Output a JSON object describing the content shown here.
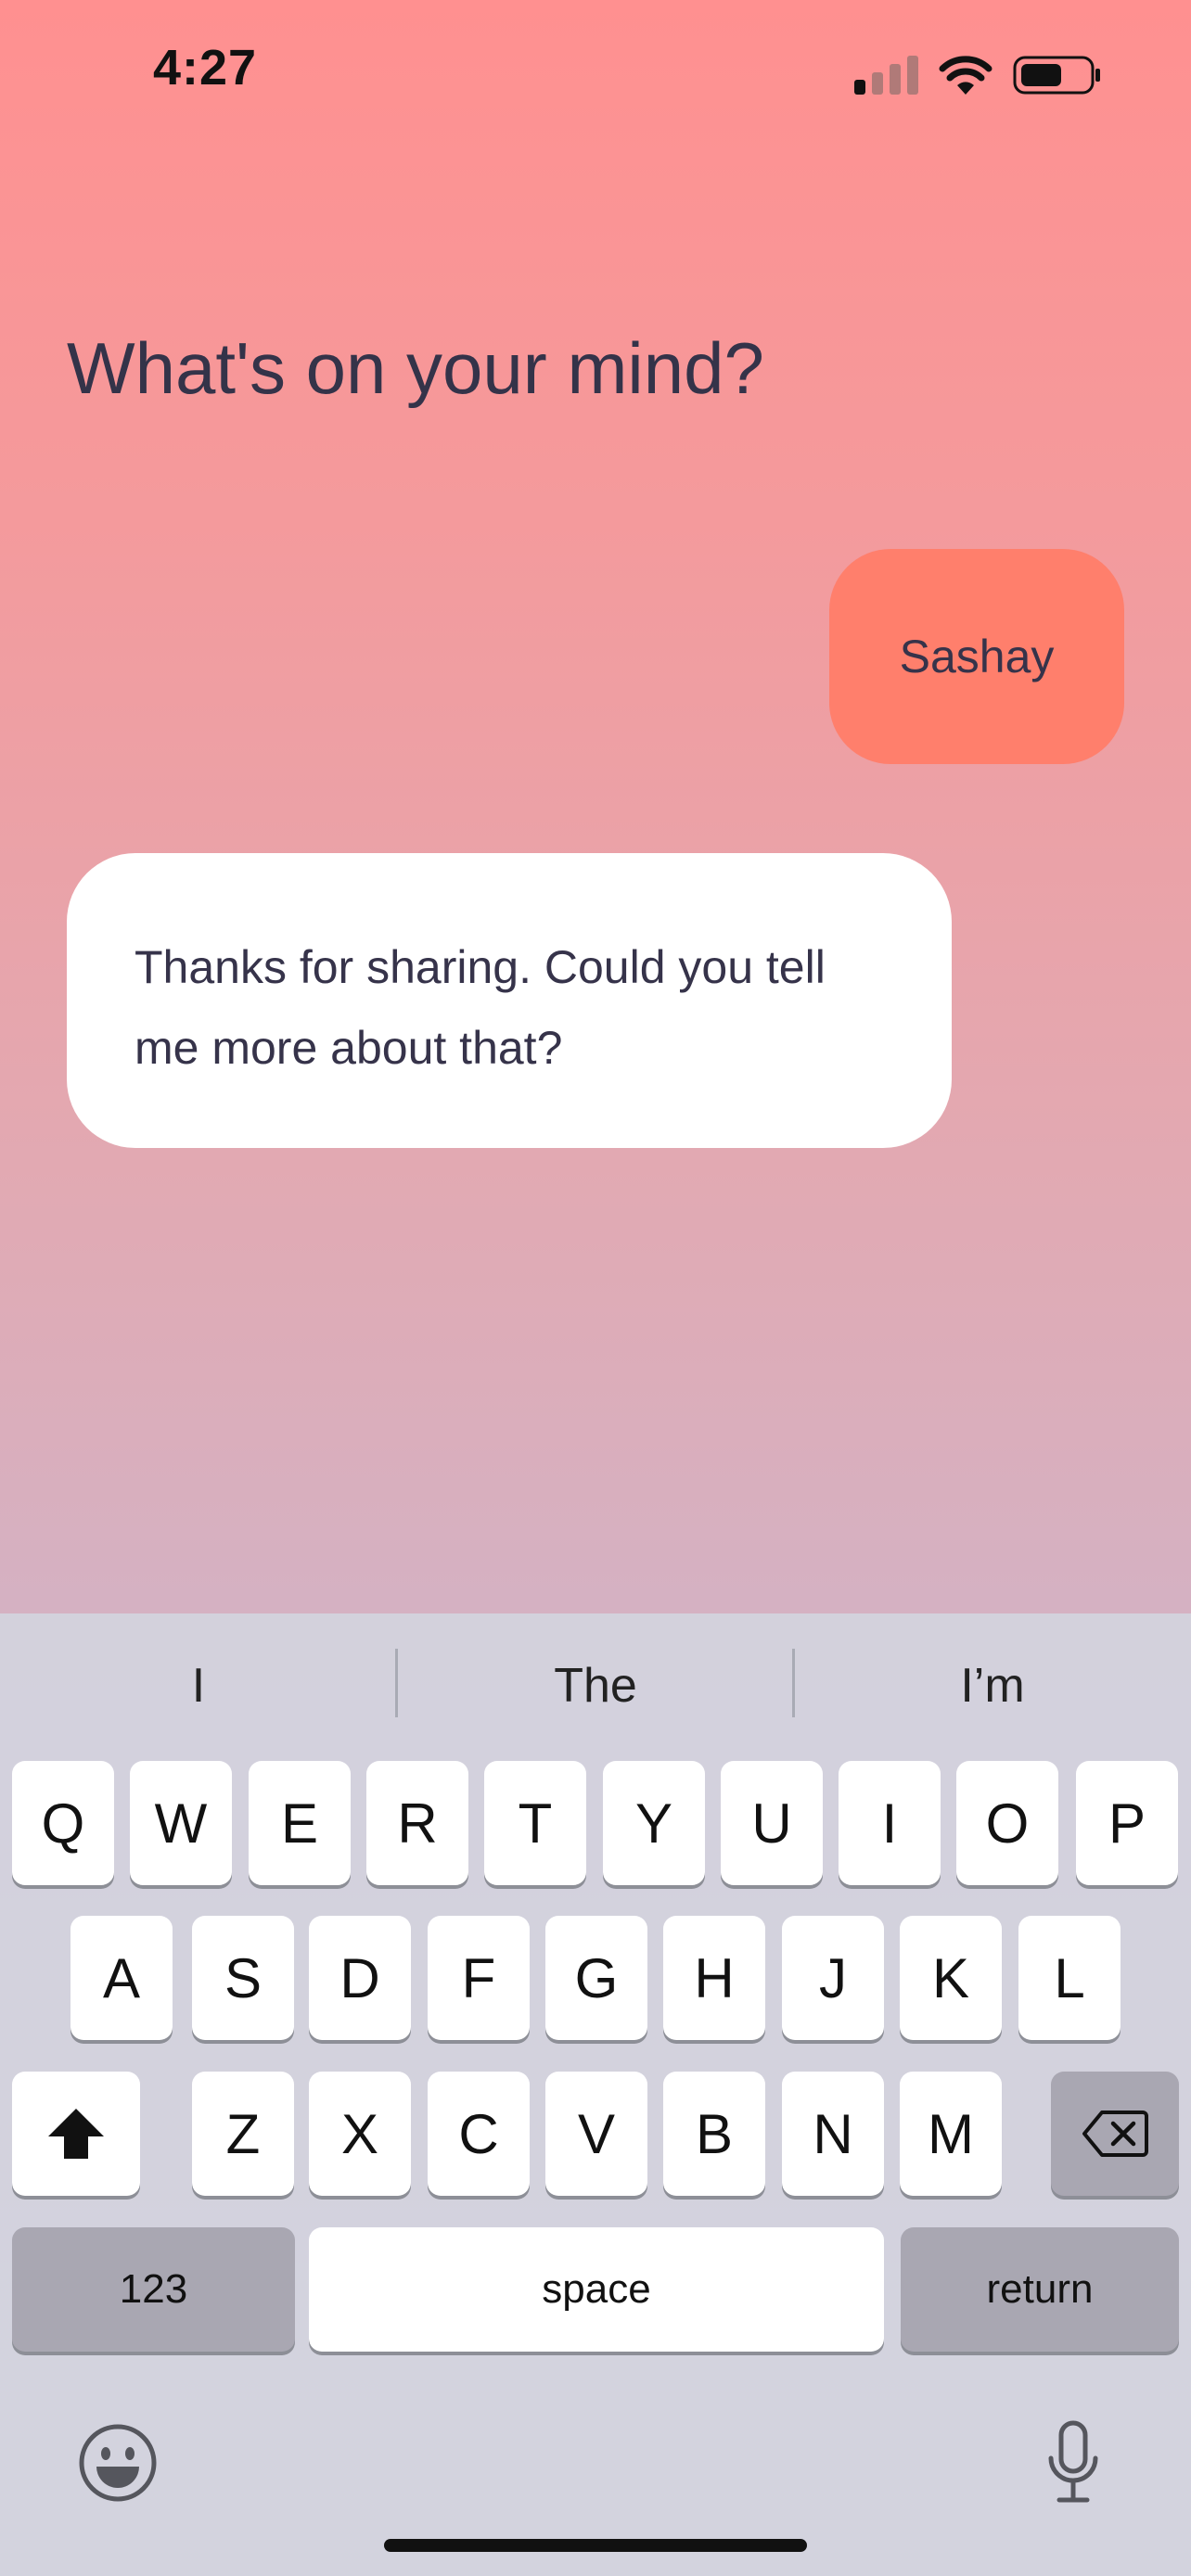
{
  "status_bar": {
    "time": "4:27",
    "signal_bars_active": 1,
    "signal_bars_total": 4
  },
  "prompt": {
    "title": "What's on your mind?"
  },
  "chat": {
    "user_message": "Sashay",
    "bot_message": "Thanks for sharing. Could you tell me more about that?",
    "user_bubble_color": "#ff7f6c",
    "bot_bubble_color": "#ffffff"
  },
  "keyboard": {
    "predictions": [
      "I",
      "The",
      "I’m"
    ],
    "row1": [
      "Q",
      "W",
      "E",
      "R",
      "T",
      "Y",
      "U",
      "I",
      "O",
      "P"
    ],
    "row2": [
      "A",
      "S",
      "D",
      "F",
      "G",
      "H",
      "J",
      "K",
      "L"
    ],
    "row3": [
      "Z",
      "X",
      "C",
      "V",
      "B",
      "N",
      "M"
    ],
    "numbers_label": "123",
    "space_label": "space",
    "return_label": "return",
    "icons": {
      "shift": "shift-icon",
      "delete": "delete-icon",
      "emoji": "emoji-icon",
      "microphone": "microphone-icon"
    }
  }
}
